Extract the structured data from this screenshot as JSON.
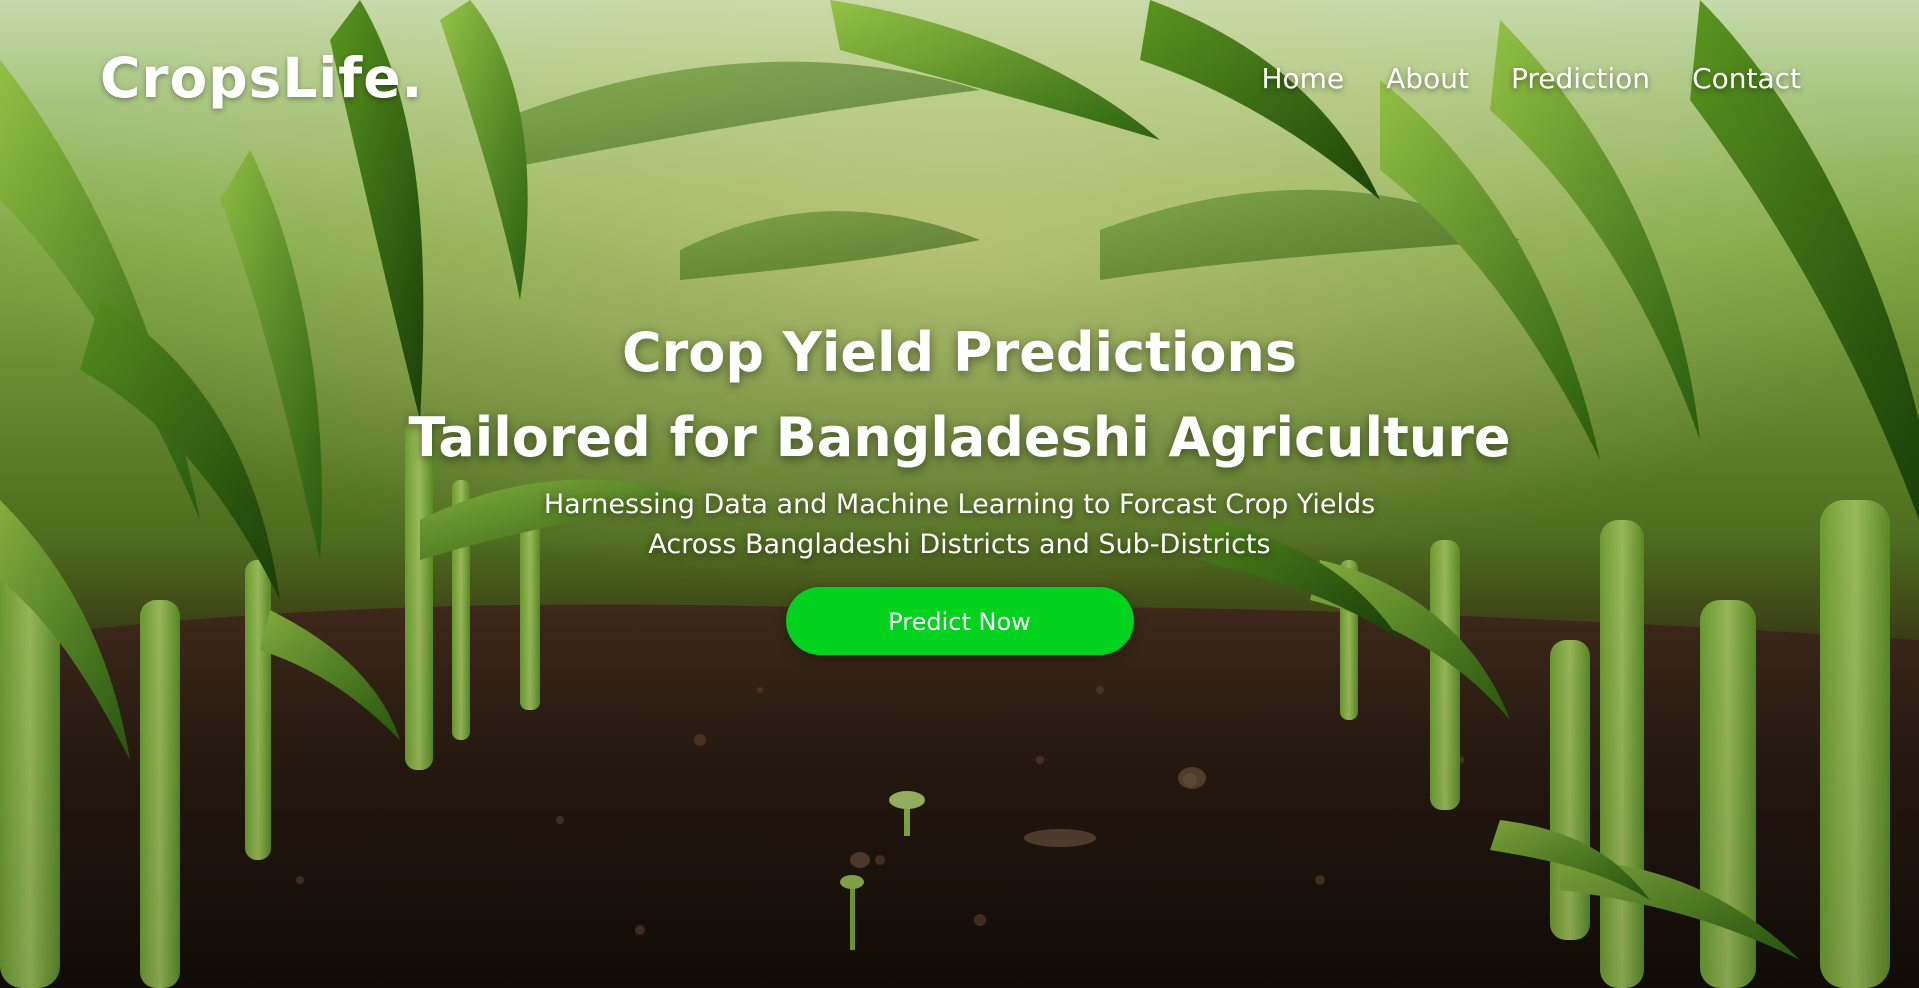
{
  "brand": {
    "logo_text": "CropsLife."
  },
  "nav": {
    "items": [
      {
        "label": "Home"
      },
      {
        "label": "About"
      },
      {
        "label": "Prediction"
      },
      {
        "label": "Contact"
      }
    ]
  },
  "hero": {
    "title_line1": "Crop Yield Predictions",
    "title_line2": "Tailored for Bangladeshi Agriculture",
    "subtitle_line1": "Harnessing Data and Machine Learning to Forcast Crop Yields",
    "subtitle_line2": "Across Bangladeshi Districts and Sub-Districts",
    "cta_label": "Predict Now"
  },
  "colors": {
    "accent": "#00d21e",
    "text": "#ffffff",
    "soil": "#2a1c12",
    "leaf": "#4f9a1c"
  },
  "background": {
    "description_icon": "corn-field-photo"
  }
}
